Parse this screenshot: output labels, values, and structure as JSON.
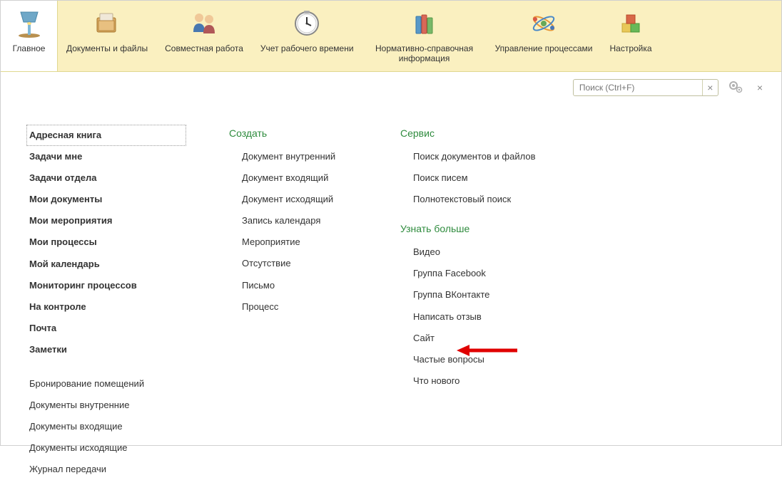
{
  "toolbar": {
    "items": [
      {
        "id": "main",
        "label": "Главное",
        "active": true
      },
      {
        "id": "docs",
        "label": "Документы и файлы",
        "active": false
      },
      {
        "id": "collab",
        "label": "Совместная работа",
        "active": false
      },
      {
        "id": "time",
        "label": "Учет рабочего времени",
        "active": false
      },
      {
        "id": "reference",
        "label": "Нормативно-справочная информация",
        "active": false
      },
      {
        "id": "process",
        "label": "Управление процессами",
        "active": false
      },
      {
        "id": "settings",
        "label": "Настройка",
        "active": false
      }
    ]
  },
  "search": {
    "placeholder": "Поиск (Ctrl+F)"
  },
  "navigation": {
    "primary": [
      {
        "label": "Адресная книга",
        "selected": true
      },
      {
        "label": "Задачи мне"
      },
      {
        "label": "Задачи отдела"
      },
      {
        "label": "Мои документы"
      },
      {
        "label": "Мои мероприятия"
      },
      {
        "label": "Мои процессы"
      },
      {
        "label": "Мой календарь"
      },
      {
        "label": "Мониторинг процессов"
      },
      {
        "label": "На контроле"
      },
      {
        "label": "Почта"
      },
      {
        "label": "Заметки"
      }
    ],
    "secondary": [
      {
        "label": "Бронирование помещений"
      },
      {
        "label": "Документы внутренние"
      },
      {
        "label": "Документы входящие"
      },
      {
        "label": "Документы исходящие"
      },
      {
        "label": "Журнал передачи"
      }
    ]
  },
  "create": {
    "header": "Создать",
    "items": [
      {
        "label": "Документ внутренний"
      },
      {
        "label": "Документ входящий"
      },
      {
        "label": "Документ исходящий"
      },
      {
        "label": "Запись календаря"
      },
      {
        "label": "Мероприятие"
      },
      {
        "label": "Отсутствие"
      },
      {
        "label": "Письмо"
      },
      {
        "label": "Процесс"
      }
    ]
  },
  "service": {
    "header": "Сервис",
    "items": [
      {
        "label": "Поиск документов и файлов"
      },
      {
        "label": "Поиск писем"
      },
      {
        "label": "Полнотекстовый поиск"
      }
    ]
  },
  "learn": {
    "header": "Узнать больше",
    "items": [
      {
        "label": "Видео"
      },
      {
        "label": "Группа Facebook"
      },
      {
        "label": "Группа ВКонтакте"
      },
      {
        "label": "Написать отзыв"
      },
      {
        "label": "Сайт"
      },
      {
        "label": "Частые вопросы"
      },
      {
        "label": "Что нового"
      }
    ]
  }
}
